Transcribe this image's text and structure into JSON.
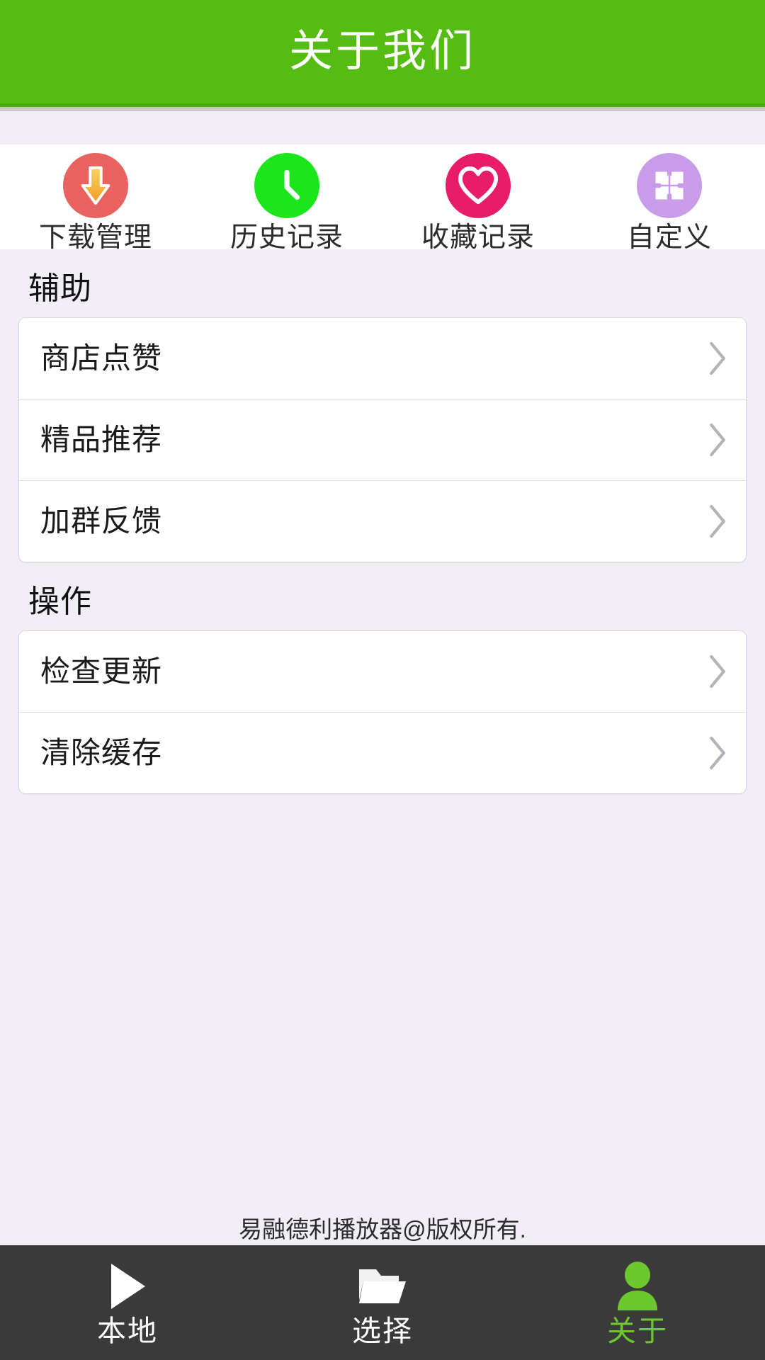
{
  "header": {
    "title": "关于我们",
    "background_color": "#55bc12",
    "title_color": "#ffffff"
  },
  "quick_actions": [
    {
      "label": "下载管理",
      "icon": "download-icon",
      "circle_color": "#e8635f",
      "glyph_color": "#f5a623"
    },
    {
      "label": "历史记录",
      "icon": "clock-icon",
      "circle_color": "#1ae61a",
      "glyph_color": "#ffffff"
    },
    {
      "label": "收藏记录",
      "icon": "heart-icon",
      "circle_color": "#e81c69",
      "glyph_color": "#ffffff"
    },
    {
      "label": "自定义",
      "icon": "puzzle-icon",
      "circle_color": "#c89ce8",
      "glyph_color": "#ffffff"
    }
  ],
  "sections": [
    {
      "title": "辅助",
      "rows": [
        {
          "label": "商店点赞",
          "accessory": "chevron-right-icon"
        },
        {
          "label": "精品推荐",
          "accessory": "chevron-right-icon"
        },
        {
          "label": "加群反馈",
          "accessory": "chevron-right-icon"
        }
      ]
    },
    {
      "title": "操作",
      "rows": [
        {
          "label": "检查更新",
          "accessory": "chevron-right-icon"
        },
        {
          "label": "清除缓存",
          "accessory": "chevron-right-icon"
        }
      ]
    }
  ],
  "footer": {
    "copyright": "易融德利播放器@版权所有."
  },
  "tabbar": {
    "background_color": "#3a3a3a",
    "active_color": "#6cc82e",
    "inactive_color": "#ffffff",
    "tabs": [
      {
        "label": "本地",
        "icon": "play-icon",
        "active": false
      },
      {
        "label": "选择",
        "icon": "folder-icon",
        "active": false
      },
      {
        "label": "关于",
        "icon": "person-icon",
        "active": true
      }
    ]
  }
}
